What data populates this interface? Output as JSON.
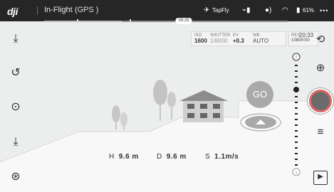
{
  "topbar": {
    "brand": "dji",
    "mode_text": "In-Flight",
    "gps_text": "(GPS )",
    "time_pill": "09:29",
    "tapfly_label": "TapFly",
    "battery_text": "61%",
    "more_label": "•••"
  },
  "camera_params": {
    "iso": {
      "label": "ISO",
      "value": "1600"
    },
    "shutter": {
      "label": "SHUTTER",
      "value": "1/8000"
    },
    "ev": {
      "label": "EV",
      "value": "+0.3"
    },
    "wb": {
      "label": "WB",
      "value": "AUTO"
    },
    "res": {
      "label": "RES",
      "value": "1080P/30"
    },
    "time": {
      "label": "",
      "value": "20:33"
    }
  },
  "progress": {
    "timeline_fraction": 0.32
  },
  "scene": {
    "go_label": "GO"
  },
  "telemetry": {
    "h_label": "H",
    "h_value": "9.6 m",
    "d_label": "D",
    "d_value": "9.6 m",
    "s_label": "S",
    "s_value": "1.1m/s"
  },
  "icons": {
    "left": [
      "takeoff-icon",
      "return-home-icon",
      "focus-target-icon",
      "land-icon",
      "more-modes-icon"
    ],
    "right": [
      "camera-switch-icon",
      "camera-mode-icon",
      "settings-sliders-icon",
      "playback-icon"
    ]
  },
  "colors": {
    "accent_shutter_ring": "#d66666",
    "ground": "#f7f7f7",
    "sky": "#e9eaea"
  }
}
